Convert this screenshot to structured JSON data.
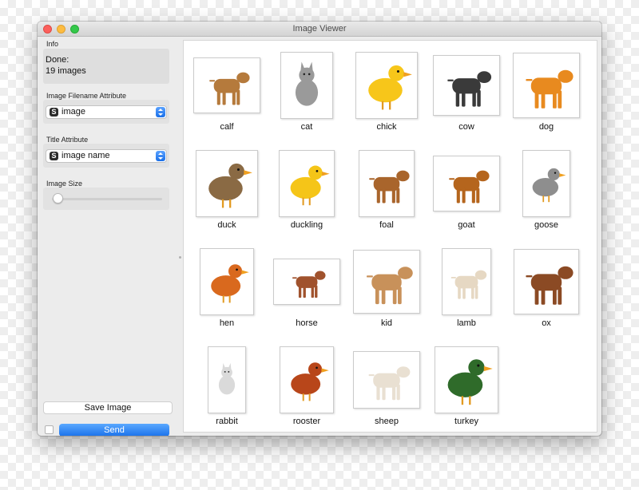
{
  "window": {
    "title": "Image Viewer"
  },
  "sidebar": {
    "info": {
      "title": "Info",
      "line1": "Done:",
      "line2": "19 images"
    },
    "filename_attr": {
      "title": "Image Filename Attribute",
      "value": "image",
      "icon": "string-variable-icon"
    },
    "title_attr": {
      "title": "Title Attribute",
      "value": "image name",
      "icon": "string-variable-icon"
    },
    "image_size": {
      "title": "Image Size",
      "level": 0.05
    },
    "save_label": "Save Image",
    "send_label": "Send",
    "auto_send_checked": false
  },
  "colors": {
    "accent": "#1a71ea",
    "close": "#fc605c",
    "minimize": "#fdbc40",
    "maximize": "#34c84a"
  },
  "images": [
    {
      "label": "calf",
      "color": "#b57a3c",
      "shape": "quad"
    },
    {
      "label": "cat",
      "color": "#9a9a9a",
      "shape": "sitting"
    },
    {
      "label": "chick",
      "color": "#f7c61a",
      "shape": "bird"
    },
    {
      "label": "cow",
      "color": "#3a3a3a",
      "shape": "quad"
    },
    {
      "label": "dog",
      "color": "#e88a1f",
      "shape": "quad"
    },
    {
      "label": "duck",
      "color": "#8a6a44",
      "shape": "bird"
    },
    {
      "label": "duckling",
      "color": "#f5c518",
      "shape": "bird"
    },
    {
      "label": "foal",
      "color": "#a9652c",
      "shape": "quad"
    },
    {
      "label": "goat",
      "color": "#b5651d",
      "shape": "quad"
    },
    {
      "label": "goose",
      "color": "#8e8e8e",
      "shape": "bird"
    },
    {
      "label": "hen",
      "color": "#d9691e",
      "shape": "bird"
    },
    {
      "label": "horse",
      "color": "#a0522d",
      "shape": "quad"
    },
    {
      "label": "kid",
      "color": "#c8915a",
      "shape": "quad"
    },
    {
      "label": "lamb",
      "color": "#e6d8c3",
      "shape": "quad"
    },
    {
      "label": "ox",
      "color": "#8b4a24",
      "shape": "quad"
    },
    {
      "label": "rabbit",
      "color": "#dadada",
      "shape": "sitting"
    },
    {
      "label": "rooster",
      "color": "#b8461a",
      "shape": "bird"
    },
    {
      "label": "sheep",
      "color": "#e9e0d2",
      "shape": "quad"
    },
    {
      "label": "turkey",
      "color": "#2f6b2a",
      "shape": "bird"
    }
  ]
}
